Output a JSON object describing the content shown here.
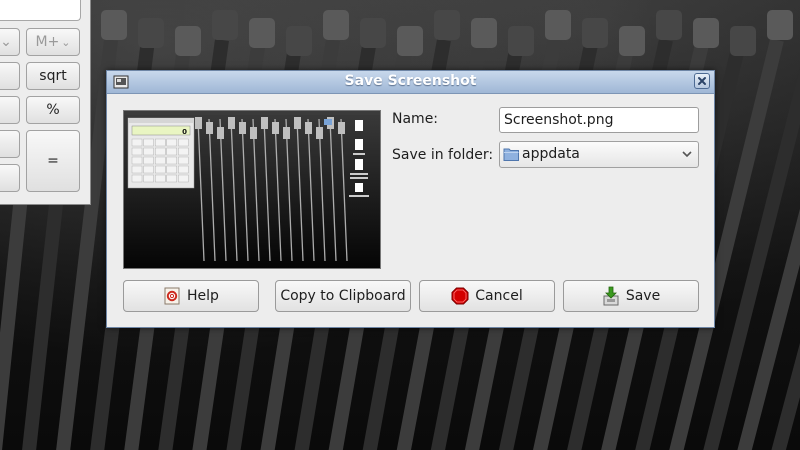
{
  "calculator": {
    "buttons": [
      "M+",
      "sqrt",
      "%",
      "="
    ]
  },
  "dialog": {
    "title": "Save Screenshot",
    "name_label": "Name:",
    "name_value": "Screenshot.png",
    "folder_label": "Save in folder:",
    "folder_value": "appdata",
    "buttons": {
      "help": "Help",
      "copy": "Copy to Clipboard",
      "cancel": "Cancel",
      "save": "Save"
    }
  },
  "preview": {
    "calc_display_value": "0"
  },
  "colors": {
    "titlebar": "#9fb7d6",
    "dialog_bg": "#ededed",
    "cancel_red": "#d40000",
    "save_green": "#3a9a1e"
  }
}
